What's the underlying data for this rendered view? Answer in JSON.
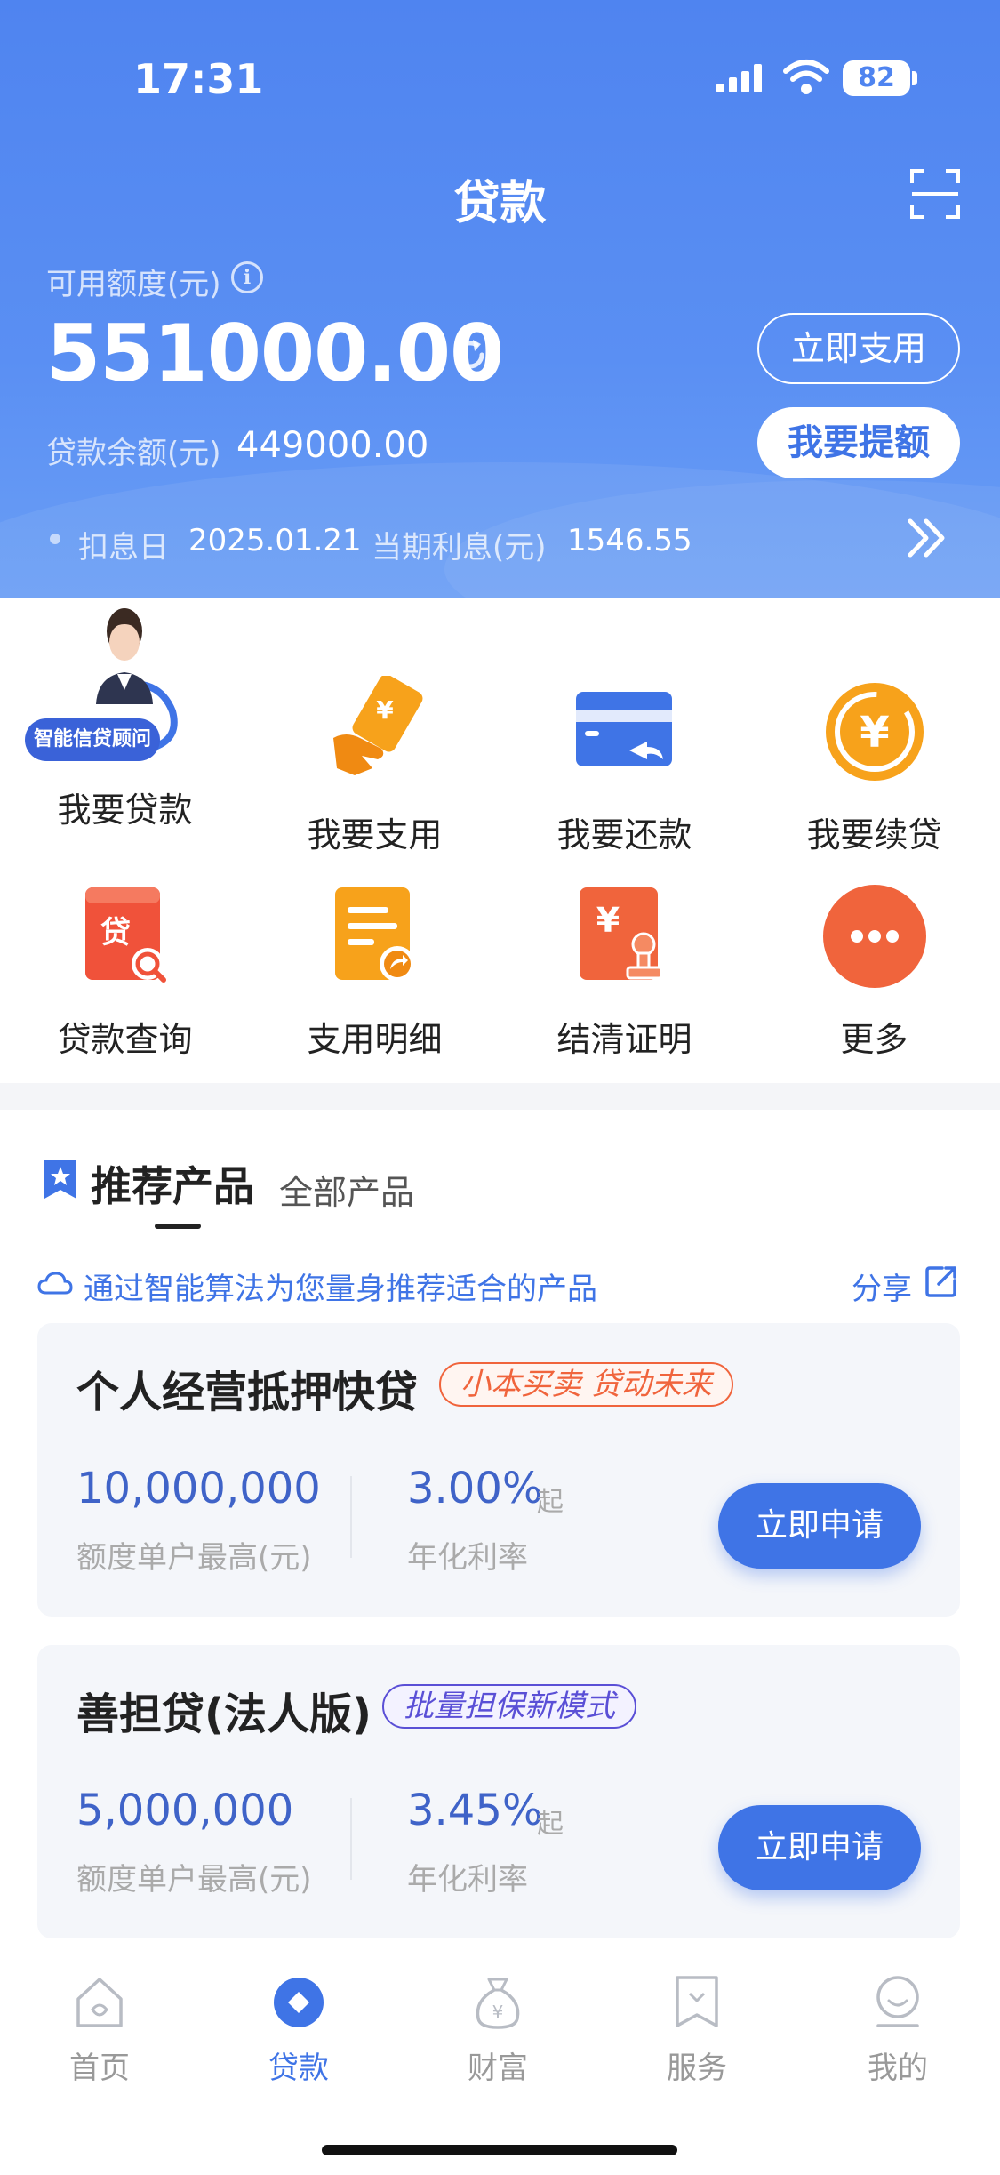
{
  "status_bar": {
    "time": "17:31",
    "battery": "82"
  },
  "header": {
    "title": "贷款",
    "available_label": "可用额度(元)",
    "available_amount": "551000.00",
    "use_button": "立即支用",
    "raise_button": "我要提额",
    "balance_label": "贷款余额(元)",
    "balance_value": "449000.00",
    "deduct_label": "扣息日",
    "deduct_value": "2025.01.21",
    "interest_label": "当期利息(元)",
    "interest_value": "1546.55"
  },
  "advisor_badge": "智能信贷顾问",
  "grid": [
    {
      "label": "我要贷款",
      "icon": "advisor-icon"
    },
    {
      "label": "我要支用",
      "icon": "hand-card-icon"
    },
    {
      "label": "我要还款",
      "icon": "card-return-icon"
    },
    {
      "label": "我要续贷",
      "icon": "yuan-coin-icon"
    },
    {
      "label": "贷款查询",
      "icon": "loan-search-icon"
    },
    {
      "label": "支用明细",
      "icon": "receipt-icon"
    },
    {
      "label": "结清证明",
      "icon": "certificate-stamp-icon"
    },
    {
      "label": "更多",
      "icon": "more-icon"
    }
  ],
  "recommend": {
    "tab_active": "推荐产品",
    "tab_other": "全部产品",
    "description": "通过智能算法为您量身推荐适合的产品",
    "share": "分享",
    "products": [
      {
        "title": "个人经营抵押快贷",
        "tag": "小本买卖 贷动未来",
        "amount": "10,000,000",
        "amount_label": "额度单户最高(元)",
        "rate": "3.00%",
        "rate_suffix": "起",
        "rate_label": "年化利率",
        "button": "立即申请"
      },
      {
        "title": "善担贷(法人版)",
        "tag": "批量担保新模式",
        "amount": "5,000,000",
        "amount_label": "额度单户最高(元)",
        "rate": "3.45%",
        "rate_suffix": "起",
        "rate_label": "年化利率",
        "button": "立即申请"
      }
    ]
  },
  "nav": [
    {
      "label": "首页",
      "icon": "home-icon"
    },
    {
      "label": "贷款",
      "icon": "loan-icon",
      "active": true
    },
    {
      "label": "财富",
      "icon": "wealth-bag-icon"
    },
    {
      "label": "服务",
      "icon": "service-icon"
    },
    {
      "label": "我的",
      "icon": "profile-icon"
    }
  ],
  "colors": {
    "primary": "#3f74e6",
    "header": "#5a8ff3",
    "accent_orange": "#f0643c",
    "icon_orange": "#f7a21b",
    "icon_red": "#f0523a"
  }
}
